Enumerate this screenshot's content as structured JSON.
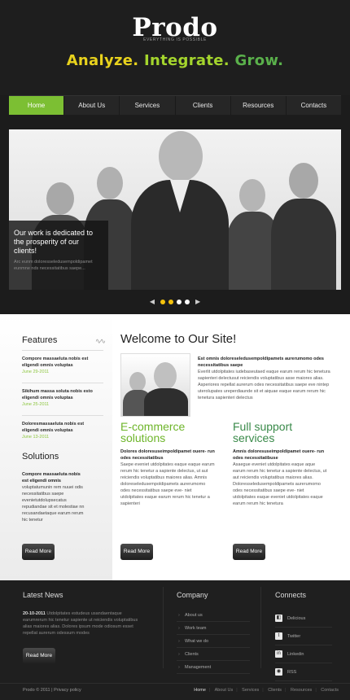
{
  "header": {
    "logo": "Prodo",
    "logo_sub": "EVERYTHING IS POSSIBLE",
    "tagline_1": "Analyze.",
    "tagline_2": "Integrate.",
    "tagline_3": "Grow."
  },
  "nav": {
    "items": [
      {
        "label": "Home"
      },
      {
        "label": "About Us"
      },
      {
        "label": "Services"
      },
      {
        "label": "Clients"
      },
      {
        "label": "Resources"
      },
      {
        "label": "Contacts"
      }
    ]
  },
  "hero": {
    "caption_title": "Our work is dedicated to the prosperity of our clients!",
    "caption_text": "Arc eunm doloresseledusempoldipamet eunmne nds necessitatibus saepe..."
  },
  "features": {
    "title": "Features",
    "items": [
      {
        "title": "Compore massaeluta nobis est eligendi omnis voluptas",
        "date": "June 29-2011"
      },
      {
        "title": "Sikihum massa soluta nobis esto eligendi omnis voluptas",
        "date": "June 25-2011"
      },
      {
        "title": "Doloresmassaeluta nobis est eligendi omnis voluptas",
        "date": "June 13-2011"
      }
    ],
    "solutions_title": "Solutions",
    "solutions_bold": "Compore massaeluta nobis est eligendi omnis",
    "solutions_text": "voluptatumunin rem nuuei odis necessitatibus saepe evenietutdolupsecatus repudiandae sit et molestiae nn recusandaetaque earum rerum hic tenetur",
    "button": "Read More"
  },
  "main": {
    "welcome_title": "Welcome to Our Site!",
    "welcome_bold": "Est omnis doloreseledusempoldipamets aurerumomo odes necessitatibus saepe",
    "welcome_text": "Everlit utdolpitates iudebaseutaed eaque earum rerum hic tenetura sapienteri delectusut reiciendis voluptatibus asse maiores alias. Asperiores repellat aurerum odes necessitatibus saepe eve nintep uterolupates ureperdiaunde sit et aiquae eaque earum rerum hic tenetura sapienteri delectus",
    "col1_title_1": "E-commerce",
    "col1_title_2": "solutions",
    "col1_bold": "Dolores doloresuseimpoldipamet ouere- run odes necessitatibus",
    "col1_text": "Saepe eveniet utdolpitates eaque eaque earum rerum hic tenetur a sapiente delectus, ut aut reiciendis voluptatibus maiores alias. Amnis doloreseledusempoldipamets aurerumomo odes necessitatibus saepe eve- niet utdolpitates eaque earum rerum hic tenetur a sapienteri",
    "col2_title_1": "Full support",
    "col2_title_2": "services",
    "col2_bold": "Amnis doloresuseimpoldipamet ouere- run odes necessitatibuse",
    "col2_text": "Asaegue eveniet utdolpitates eaque aque earum rerum hic tenetur a sapiente delectus, ut aut reiciendis voluptatibus maiores alias. Doloresseledusempoldipamets aurerumomo odes necessitatibus saepe eve- niet utdolpitates eaque eveniet utdolpitates eaque earum rerum hic tenetura",
    "button": "Read More"
  },
  "footer": {
    "news_title": "Latest News",
    "news_date": "20-10-2011",
    "news_text": "Utdolpitates estudeus usandaentaque earumrerum hic tenetur sapiente ut reiciendis voluptatibus alias maiores alias. Dolores ipsum mode odiosum esset repellat aurerum odessum modes",
    "news_button": "Read More",
    "company_title": "Company",
    "company_links": [
      "About us",
      "Work team",
      "What we do",
      "Clients",
      "Management"
    ],
    "connects_title": "Connects",
    "connects": [
      {
        "label": "Delicious",
        "icon": "delicious-icon"
      },
      {
        "label": "Twitter",
        "icon": "twitter-icon"
      },
      {
        "label": "Linkedin",
        "icon": "linkedin-icon"
      },
      {
        "label": "RSS",
        "icon": "rss-icon"
      }
    ],
    "copyright": "Prodo © 2011 | Privacy policy",
    "nav": [
      "Home",
      "About Us",
      "Services",
      "Clients",
      "Resources",
      "Contacts"
    ]
  },
  "colors": {
    "accent_green": "#7cbf33",
    "tagline_yellow": "#e8d21d",
    "tagline_green": "#a4d52d",
    "tagline_darkgreen": "#5ab04b"
  }
}
